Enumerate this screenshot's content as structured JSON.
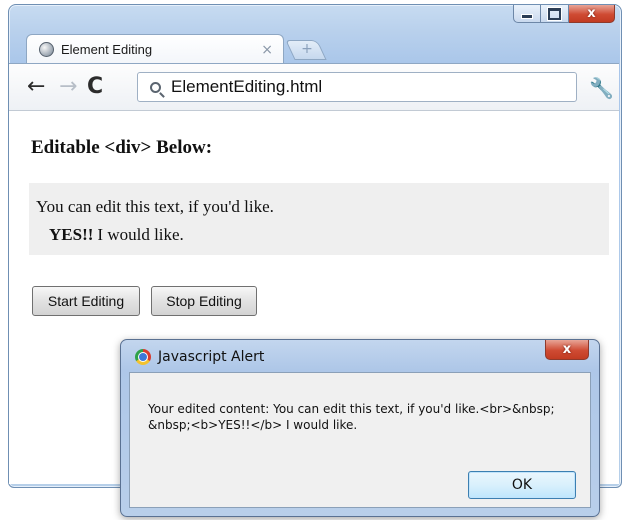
{
  "browser": {
    "tab": {
      "title": "Element Editing",
      "close_glyph": "×",
      "icon": "globe-icon"
    },
    "new_tab_glyph": "+",
    "window_controls": {
      "minimize": "minimize-icon",
      "maximize": "maximize-icon",
      "close_glyph": "x"
    },
    "toolbar": {
      "back_glyph": "←",
      "forward_glyph": "→",
      "reload_glyph": "C",
      "url": "ElementEditing.html",
      "wrench_glyph": "🔧"
    }
  },
  "page": {
    "heading": "Editable <div> Below:",
    "editable": {
      "line1": "You can edit this text, if you'd like.",
      "line2_bold": "YES!!",
      "line2_rest": "I would like."
    },
    "buttons": {
      "start": "Start Editing",
      "stop": "Stop Editing"
    }
  },
  "alert": {
    "title": "Javascript Alert",
    "close_glyph": "x",
    "message": "Your edited content: You can edit this text, if you'd like.<br>&nbsp; &nbsp;<b>YES!!</b> I would like.",
    "ok_label": "OK"
  },
  "colors": {
    "frame": "#b8d0ec",
    "close_button": "#cf4b33",
    "editable_bg": "#efefef",
    "ok_button_border": "#3c7fb1"
  }
}
